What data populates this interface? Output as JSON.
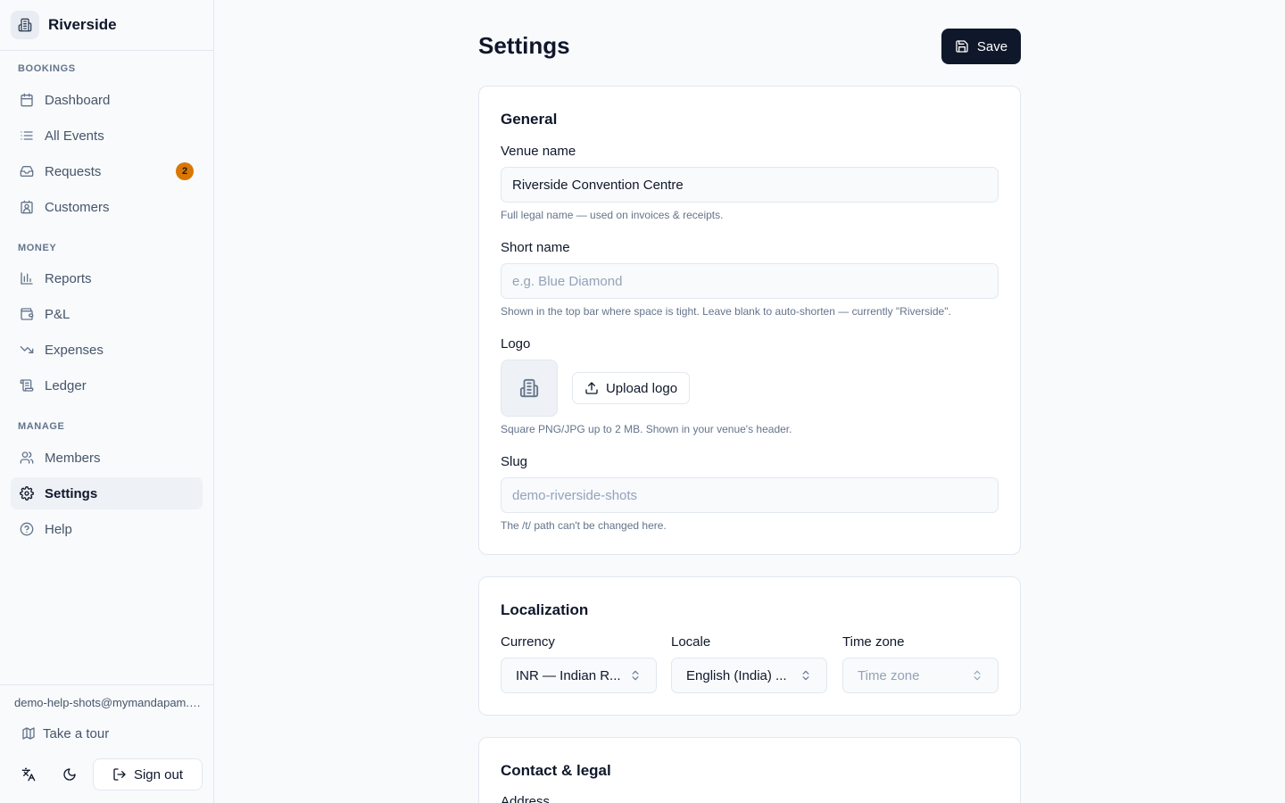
{
  "brand": {
    "name": "Riverside"
  },
  "sidebar": {
    "sections": [
      {
        "label": "BOOKINGS"
      },
      {
        "label": "MONEY"
      },
      {
        "label": "MANAGE"
      }
    ],
    "items": [
      {
        "label": "Dashboard",
        "icon": "calendar-icon"
      },
      {
        "label": "All Events",
        "icon": "list-icon"
      },
      {
        "label": "Requests",
        "icon": "inbox-icon",
        "badge": "2"
      },
      {
        "label": "Customers",
        "icon": "contact-icon"
      },
      {
        "label": "Reports",
        "icon": "bar-chart-icon"
      },
      {
        "label": "P&L",
        "icon": "wallet-icon"
      },
      {
        "label": "Expenses",
        "icon": "trending-down-icon"
      },
      {
        "label": "Ledger",
        "icon": "scroll-icon"
      },
      {
        "label": "Members",
        "icon": "users-icon"
      },
      {
        "label": "Settings",
        "icon": "gear-icon",
        "active": true
      },
      {
        "label": "Help",
        "icon": "help-circle-icon"
      }
    ],
    "footer": {
      "email": "demo-help-shots@mymandapam.com",
      "tour_label": "Take a tour",
      "sign_out_label": "Sign out"
    }
  },
  "header": {
    "title": "Settings",
    "save_label": "Save"
  },
  "general": {
    "title": "General",
    "venue_name": {
      "label": "Venue name",
      "value": "Riverside Convention Centre",
      "hint": "Full legal name — used on invoices & receipts."
    },
    "short_name": {
      "label": "Short name",
      "placeholder": "e.g. Blue Diamond",
      "hint": "Shown in the top bar where space is tight. Leave blank to auto-shorten — currently \"Riverside\"."
    },
    "logo": {
      "label": "Logo",
      "upload_label": "Upload logo",
      "hint": "Square PNG/JPG up to 2 MB. Shown in your venue's header."
    },
    "slug": {
      "label": "Slug",
      "value": "demo-riverside-shots",
      "hint": "The /t/ path can't be changed here."
    }
  },
  "localization": {
    "title": "Localization",
    "currency": {
      "label": "Currency",
      "value": "INR — Indian R..."
    },
    "locale": {
      "label": "Locale",
      "value": "English (India) ..."
    },
    "timezone": {
      "label": "Time zone",
      "placeholder": "Time zone"
    }
  },
  "contact": {
    "title": "Contact & legal",
    "address_label": "Address"
  },
  "colors": {
    "primary": "#0f172a",
    "badge": "#d97706",
    "border": "#e2e8f0",
    "muted": "#64748b"
  }
}
